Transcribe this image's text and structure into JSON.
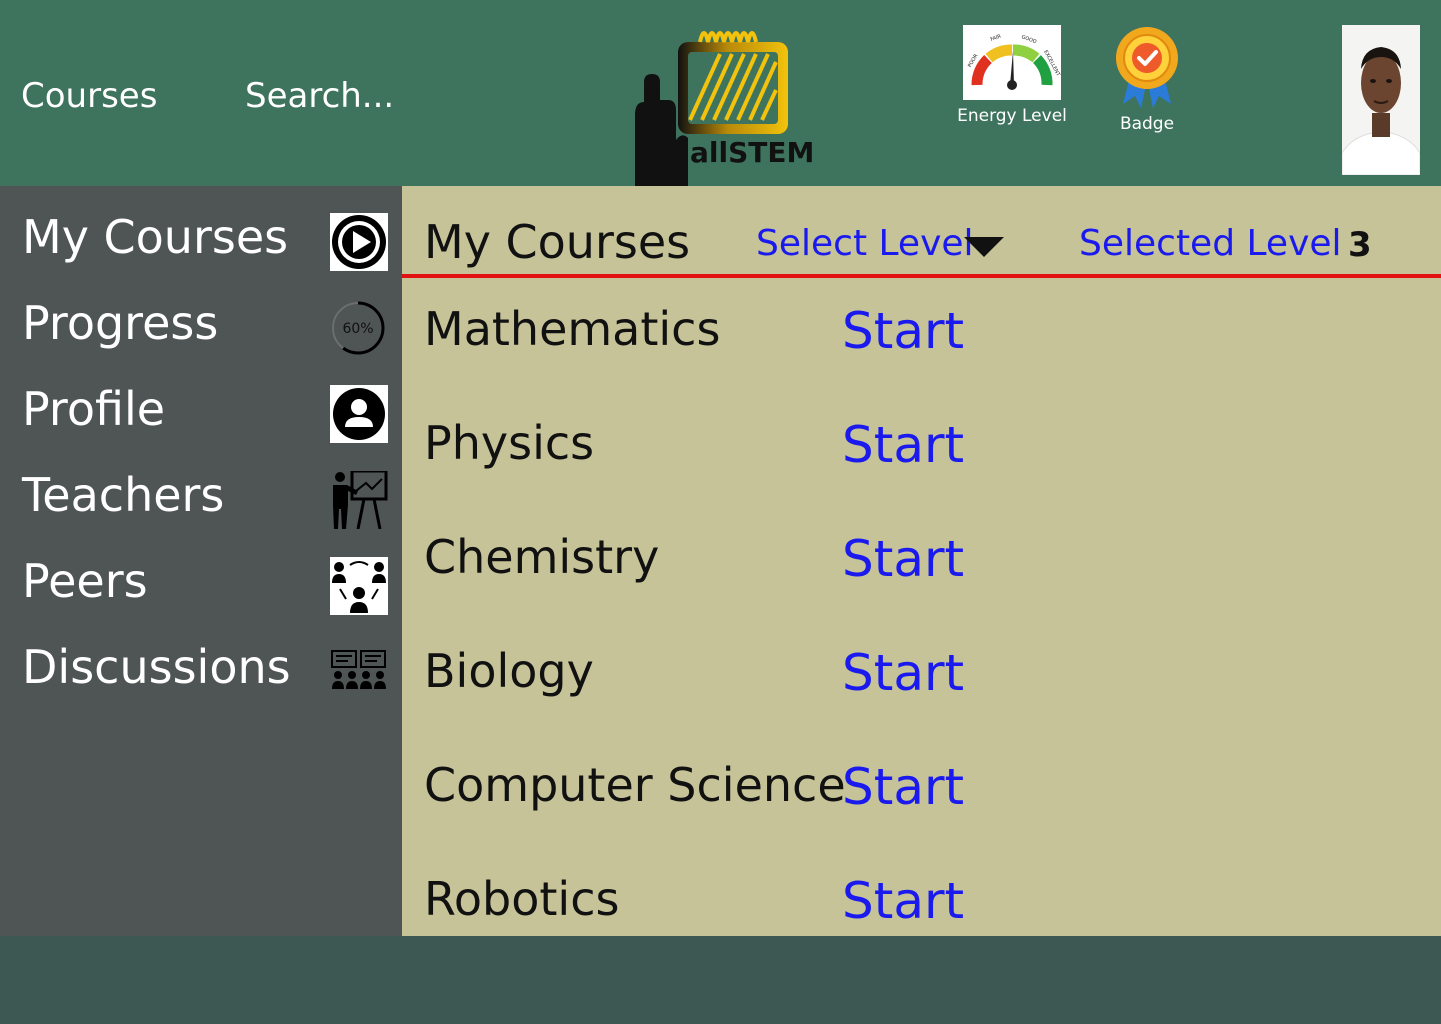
{
  "header": {
    "nav": {
      "courses": "Courses",
      "search": "Search..."
    },
    "logo_text": "allSTEM",
    "stats": {
      "energy": {
        "label": "Energy Level",
        "gauge_labels": [
          "POOR",
          "FAIR",
          "GOOD",
          "EXCELLENT"
        ]
      },
      "badge": {
        "label": "Badge"
      }
    }
  },
  "sidebar": {
    "items": [
      {
        "label": "My Courses",
        "icon": "play-icon"
      },
      {
        "label": "Progress",
        "icon": "progress-ring-icon",
        "progress_text": "60%",
        "progress": 0.6
      },
      {
        "label": "Profile",
        "icon": "user-icon"
      },
      {
        "label": "Teachers",
        "icon": "teacher-icon"
      },
      {
        "label": "Peers",
        "icon": "peers-icon"
      },
      {
        "label": "Discussions",
        "icon": "discussion-icon"
      }
    ]
  },
  "main": {
    "title": "My Courses",
    "select_level": "Select Level",
    "selected_level_label": "Selected Level",
    "selected_level_value": "3",
    "courses": [
      {
        "name": "Mathematics",
        "action": "Start"
      },
      {
        "name": "Physics",
        "action": "Start"
      },
      {
        "name": "Chemistry",
        "action": "Start"
      },
      {
        "name": "Biology",
        "action": "Start"
      },
      {
        "name": "Computer Science",
        "action": "Start"
      },
      {
        "name": "Robotics",
        "action": "Start"
      }
    ]
  },
  "colors": {
    "header_bg": "#3e735e",
    "sidebar_bg": "#4f5454",
    "main_bg": "#c6c398",
    "link_blue": "#1a1aee",
    "divider_red": "#e21212"
  }
}
